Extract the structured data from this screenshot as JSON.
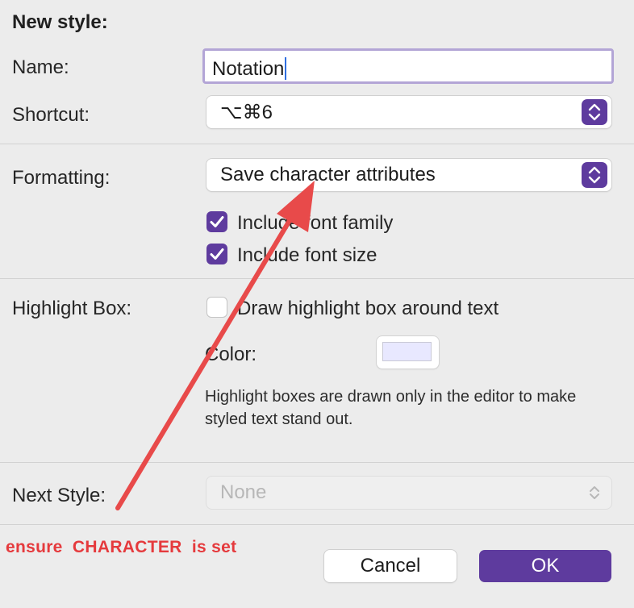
{
  "dialog": {
    "title": "New style:",
    "name_label": "Name:",
    "name_value": "Notation",
    "shortcut_label": "Shortcut:",
    "shortcut_value": "⌥⌘6",
    "formatting_label": "Formatting:",
    "formatting_value": "Save character attributes",
    "include_font_family": {
      "label": "Include font family",
      "checked": true
    },
    "include_font_size": {
      "label": "Include font size",
      "checked": true
    },
    "highlight_label": "Highlight Box:",
    "draw_highlight": {
      "label": "Draw highlight box around text",
      "checked": false
    },
    "color_label": "Color:",
    "highlight_color": "#e8e8ff",
    "help_text": "Highlight boxes are drawn only in the editor to make styled text stand out.",
    "next_style_label": "Next Style:",
    "next_style_value": "None",
    "cancel_label": "Cancel",
    "ok_label": "OK"
  },
  "annotation": {
    "text": "ensure  CHARACTER  is set",
    "color": "#e53a3d"
  },
  "colors": {
    "accent": "#5e3b9e",
    "focus_ring": "#b3a5d6"
  }
}
